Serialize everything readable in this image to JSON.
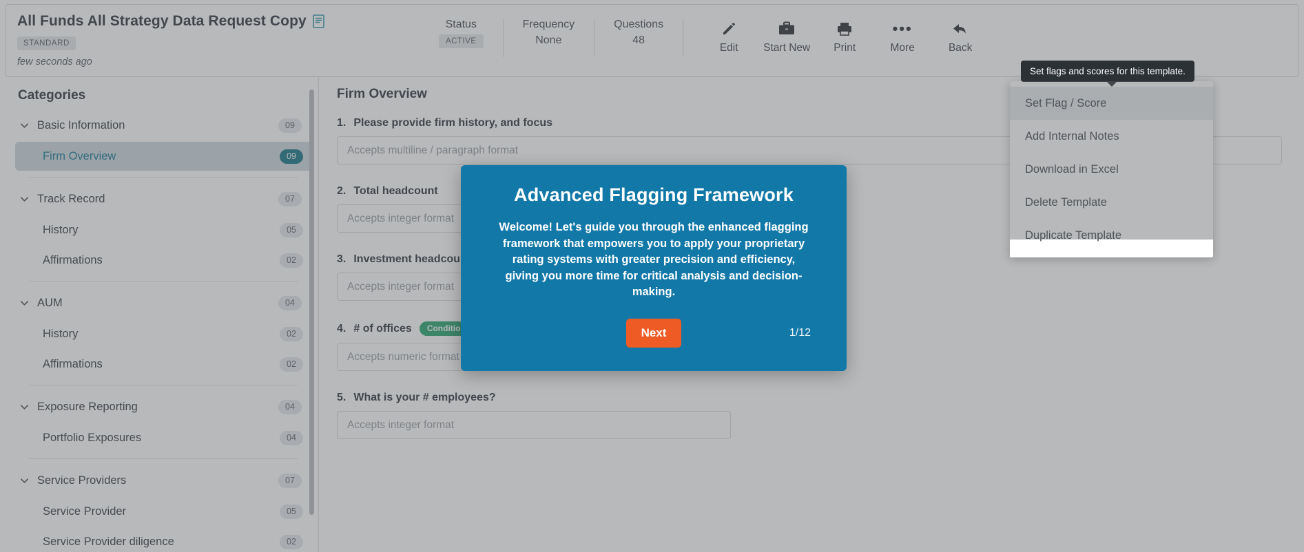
{
  "header": {
    "title": "All Funds All Strategy Data Request Copy",
    "doc_icon": "document-icon",
    "type_badge": "STANDARD",
    "updated": "few seconds ago",
    "stats": [
      {
        "label": "Status",
        "value": "ACTIVE",
        "badge": true
      },
      {
        "label": "Frequency",
        "value": "None",
        "badge": false
      },
      {
        "label": "Questions",
        "value": "48",
        "badge": false
      }
    ],
    "actions": [
      {
        "icon": "pencil-icon",
        "label": "Edit"
      },
      {
        "icon": "briefcase-icon",
        "label": "Start New"
      },
      {
        "icon": "printer-icon",
        "label": "Print"
      },
      {
        "icon": "ellipsis-icon",
        "label": "More"
      },
      {
        "icon": "back-arrow-icon",
        "label": "Back"
      }
    ]
  },
  "sidebar": {
    "title": "Categories",
    "groups": [
      {
        "name": "Basic Information",
        "count": "09",
        "items": [
          {
            "name": "Firm Overview",
            "count": "09",
            "selected": true
          }
        ]
      },
      {
        "name": "Track Record",
        "count": "07",
        "items": [
          {
            "name": "History",
            "count": "05",
            "selected": false
          },
          {
            "name": "Affirmations",
            "count": "02",
            "selected": false
          }
        ]
      },
      {
        "name": "AUM",
        "count": "04",
        "items": [
          {
            "name": "History",
            "count": "02",
            "selected": false
          },
          {
            "name": "Affirmations",
            "count": "02",
            "selected": false
          }
        ]
      },
      {
        "name": "Exposure Reporting",
        "count": "04",
        "items": [
          {
            "name": "Portfolio Exposures",
            "count": "04",
            "selected": false
          }
        ]
      },
      {
        "name": "Service Providers",
        "count": "07",
        "items": [
          {
            "name": "Service Provider",
            "count": "05",
            "selected": false
          },
          {
            "name": "Service Provider diligence",
            "count": "02",
            "selected": false
          }
        ]
      }
    ]
  },
  "content": {
    "section_title": "Firm Overview",
    "questions": [
      {
        "number": "1.",
        "text": "Please provide firm history, and focus",
        "placeholder": "Accepts multiline / paragraph format",
        "badge": "",
        "width": "wide"
      },
      {
        "number": "2.",
        "text": "Total headcount",
        "placeholder": "Accepts integer format",
        "badge": "",
        "width": "narrow"
      },
      {
        "number": "3.",
        "text": "Investment headcount",
        "placeholder": "Accepts integer format",
        "badge": "",
        "width": "narrow"
      },
      {
        "number": "4.",
        "text": "# of offices",
        "placeholder": "Accepts numeric format",
        "badge": "Conditional",
        "width": "narrow"
      },
      {
        "number": "5.",
        "text": "What is your # employees?",
        "placeholder": "Accepts integer format",
        "badge": "",
        "width": "narrow"
      }
    ]
  },
  "menu": {
    "tooltip": "Set flags and scores for this template.",
    "items": [
      {
        "label": "Set Flag / Score",
        "hover": true
      },
      {
        "label": "Add Internal Notes",
        "hover": false
      },
      {
        "label": "Download in Excel",
        "hover": false
      },
      {
        "label": "Delete Template",
        "hover": false
      },
      {
        "label": "Duplicate Template",
        "hover": false
      }
    ]
  },
  "walkthrough": {
    "title": "Advanced Flagging Framework",
    "body": "Welcome! Let's guide you through the enhanced flagging framework that empowers you to apply your proprietary rating systems with greater precision and efficiency, giving you more time for critical analysis and decision-making.",
    "next_label": "Next",
    "step": "1/12",
    "accent_color": "#1278a8",
    "button_color": "#ef5b25"
  }
}
